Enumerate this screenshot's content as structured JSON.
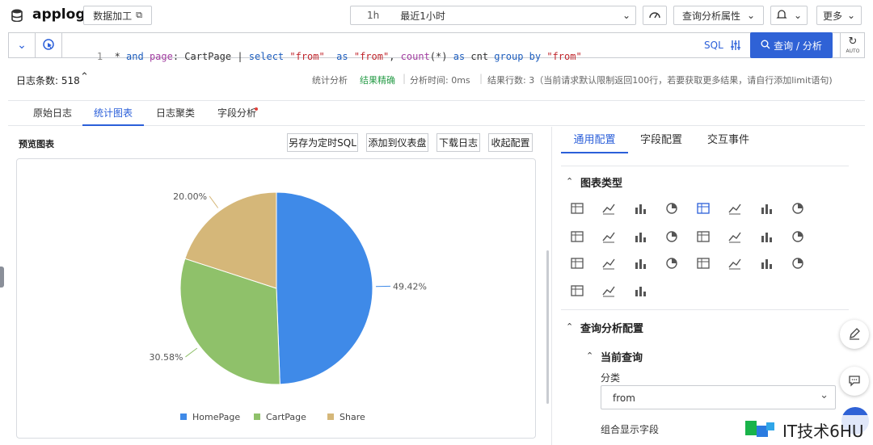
{
  "header": {
    "project": "applog",
    "data_process_label": "数据加工",
    "time_badge": "1h",
    "time_range": "最近1小时",
    "analysis_props_label": "查询分析属性",
    "more_label": "更多"
  },
  "query": {
    "line_no": "1",
    "tokens": [
      {
        "t": "*",
        "c": "tok-plain"
      },
      {
        "t": " and ",
        "c": "tok-kw"
      },
      {
        "t": "page",
        "c": "tok-id"
      },
      {
        "t": ": CartPage ",
        "c": "tok-plain"
      },
      {
        "t": "| ",
        "c": "tok-plain"
      },
      {
        "t": "select ",
        "c": "tok-kw"
      },
      {
        "t": "\"from\"",
        "c": "tok-str"
      },
      {
        "t": "  as ",
        "c": "tok-kw"
      },
      {
        "t": "\"from\"",
        "c": "tok-str"
      },
      {
        "t": ", ",
        "c": "tok-plain"
      },
      {
        "t": "count",
        "c": "tok-fn"
      },
      {
        "t": "(*) ",
        "c": "tok-plain"
      },
      {
        "t": "as ",
        "c": "tok-kw"
      },
      {
        "t": "cnt ",
        "c": "tok-plain"
      },
      {
        "t": "group by ",
        "c": "tok-kw"
      },
      {
        "t": "\"from\"",
        "c": "tok-str"
      }
    ],
    "sql_badge": "SQL",
    "search_label": "查询 / 分析",
    "auto_label": "AUTO"
  },
  "status": {
    "log_count_label": "日志条数: 518",
    "stat_label": "统计分析",
    "precise_label": "结果精确",
    "analysis_time": "分析时间: 0ms",
    "result_rows": "结果行数: 3（当前请求默认限制返回100行，若要获取更多结果，请自行添加limit语句)"
  },
  "tabs": [
    "原始日志",
    "统计图表",
    "日志聚类",
    "字段分析"
  ],
  "preview": {
    "title": "预览图表",
    "save_sql": "另存为定时SQL",
    "add_dashboard": "添加到仪表盘",
    "download_log": "下载日志",
    "collapse_config": "收起配置"
  },
  "chart_data": {
    "type": "pie",
    "categories": [
      "HomePage",
      "CartPage",
      "Share"
    ],
    "values": [
      49.42,
      30.58,
      20.0
    ],
    "labels": [
      "49.42%",
      "30.58%",
      "20.00%"
    ],
    "colors": [
      "#3f8ae8",
      "#8fc16a",
      "#d5b779"
    ],
    "legend": "bottom"
  },
  "config": {
    "tabs": [
      "通用配置",
      "字段配置",
      "交互事件"
    ],
    "chart_type_title": "图表类型",
    "query_analysis_title": "查询分析配置",
    "current_query_title": "当前查询",
    "category_label": "分类",
    "category_value": "from",
    "combined_field_label": "组合显示字段"
  },
  "watermark": "IT技术6HU"
}
